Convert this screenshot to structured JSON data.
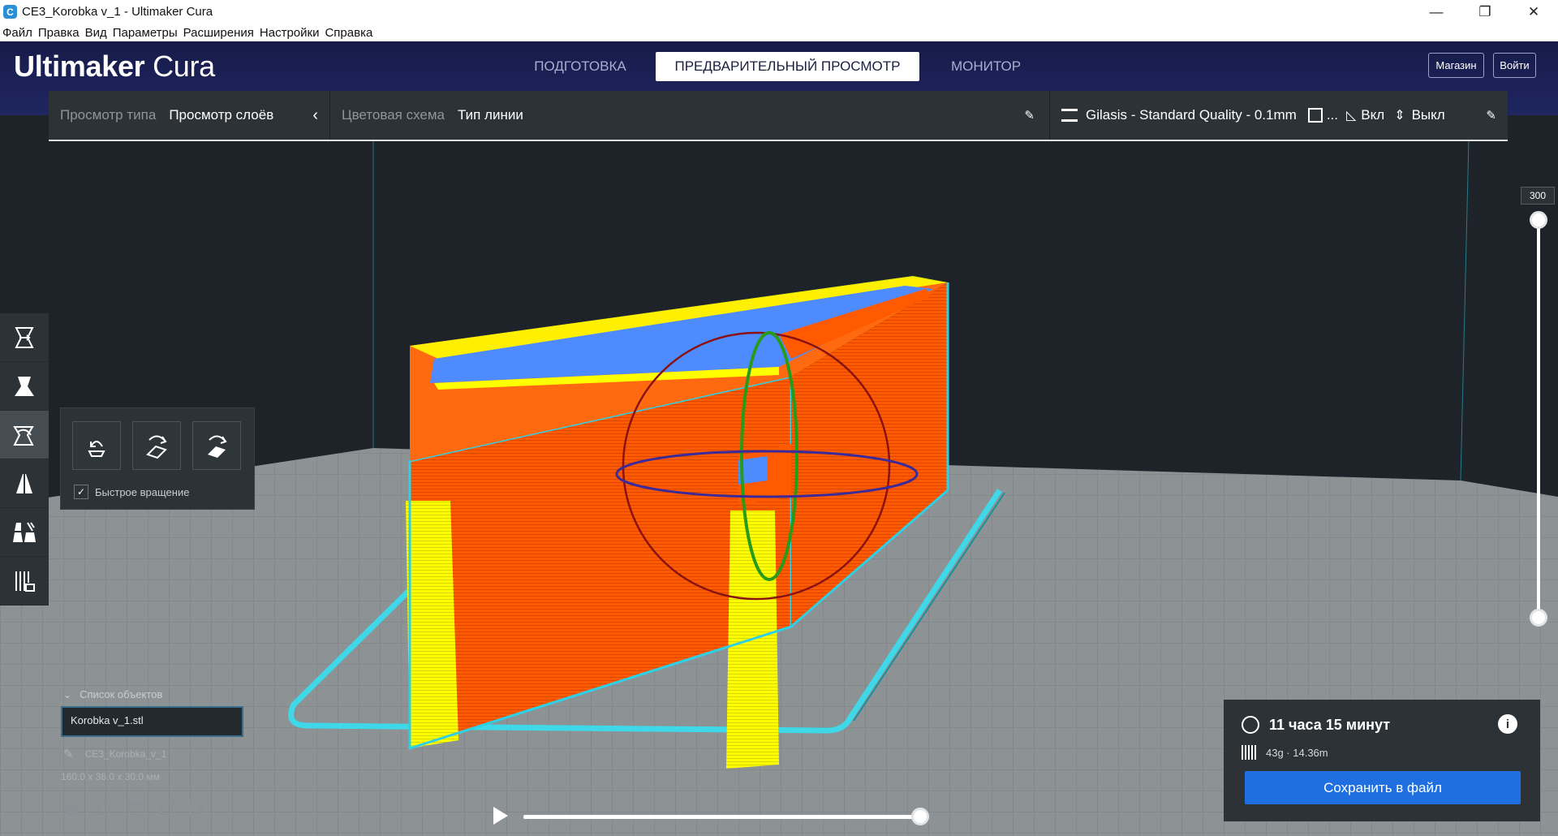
{
  "window": {
    "title": "CE3_Korobka v_1 - Ultimaker Cura",
    "app_icon": "C",
    "minimize": "—",
    "maximize": "❐",
    "close": "✕"
  },
  "menu": [
    "Файл",
    "Правка",
    "Вид",
    "Параметры",
    "Расширения",
    "Настройки",
    "Справка"
  ],
  "header": {
    "logo_bold": "Ultimaker",
    "logo_light": " Cura",
    "tabs": [
      "ПОДГОТОВКА",
      "ПРЕДВАРИТЕЛЬНЫЙ ПРОСМОТР",
      "МОНИТОР"
    ],
    "active_tab": "ПРЕДВАРИТЕЛЬНЫЙ ПРОСМОТР",
    "marketplace": "Магазин",
    "signin": "Войти"
  },
  "toolbar": {
    "view_type_label": "Просмотр типа",
    "view_type_value": "Просмотр слоёв",
    "color_scheme_label": "Цветовая схема",
    "color_scheme_value": "Тип линии",
    "profile": "Gilasis - Standard Quality - 0.1mm",
    "ellipsis": "...",
    "support_state": "Вкл",
    "adhesion_state": "Выкл"
  },
  "tools": [
    "translate-tool",
    "scale-tool",
    "rotate-tool",
    "mirror-tool",
    "per-model-settings-tool",
    "support-blocker-tool"
  ],
  "rotate_panel": {
    "buttons": [
      "reset-rotation",
      "lay-flat",
      "select-face-to-align"
    ],
    "snap_label": "Быстрое вращение",
    "snap_checked": true
  },
  "object_list": {
    "header": "Список объектов",
    "item": "Korobka v_1.stl",
    "job_name": "CE3_Korobka_v_1",
    "dimensions": "160.0 x 36.0 x 30.0 мм"
  },
  "layer_slider": {
    "max_layer": "300",
    "level": 1.0
  },
  "play_slider": {
    "progress": 1.0
  },
  "print_info": {
    "time": "11 часа 15 минут",
    "material": "43g · 14.36m",
    "save_button": "Сохранить в файл"
  },
  "colors": {
    "header_bg": "#1b1f52",
    "accent_blue": "#1f6fe0",
    "wall_orange": "#ff5a00",
    "wall_yellow": "#ffff00",
    "skirt_cyan": "#3fd8e8",
    "infill_blue": "#4d8bff"
  }
}
